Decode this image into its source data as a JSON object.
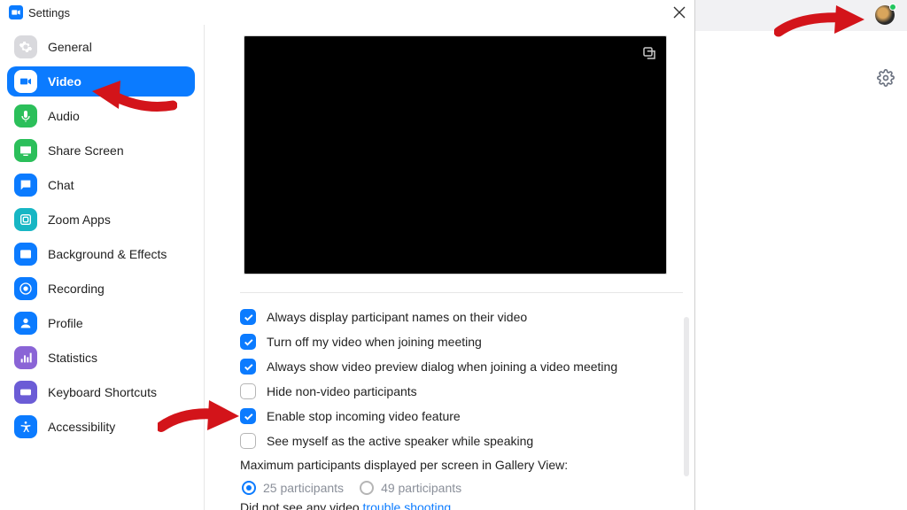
{
  "window": {
    "title": "Settings"
  },
  "sidebar": {
    "items": [
      {
        "label": "General",
        "color": "#d9d9dd",
        "icon": "gear"
      },
      {
        "label": "Video",
        "color": "#0b7bff",
        "icon": "video",
        "active": true
      },
      {
        "label": "Audio",
        "color": "#2bbf5a",
        "icon": "audio"
      },
      {
        "label": "Share Screen",
        "color": "#2bbf5a",
        "icon": "share"
      },
      {
        "label": "Chat",
        "color": "#0b7bff",
        "icon": "chat"
      },
      {
        "label": "Zoom Apps",
        "color": "#17b6c4",
        "icon": "apps"
      },
      {
        "label": "Background & Effects",
        "color": "#0b7bff",
        "icon": "bgfx"
      },
      {
        "label": "Recording",
        "color": "#0b7bff",
        "icon": "record"
      },
      {
        "label": "Profile",
        "color": "#0b7bff",
        "icon": "profile"
      },
      {
        "label": "Statistics",
        "color": "#8a64d6",
        "icon": "stats"
      },
      {
        "label": "Keyboard Shortcuts",
        "color": "#6b5cd6",
        "icon": "keys"
      },
      {
        "label": "Accessibility",
        "color": "#0b7bff",
        "icon": "a11y"
      }
    ]
  },
  "video": {
    "options": [
      {
        "label": "Always display participant names on their video",
        "checked": true
      },
      {
        "label": "Turn off my video when joining meeting",
        "checked": true
      },
      {
        "label": "Always show video preview dialog when joining a video meeting",
        "checked": true
      },
      {
        "label": "Hide non-video participants",
        "checked": false
      },
      {
        "label": "Enable stop incoming video feature",
        "checked": true
      },
      {
        "label": "See myself as the active speaker while speaking",
        "checked": false
      }
    ],
    "gallery_label": "Maximum participants displayed per screen in Gallery View:",
    "gallery_options": [
      {
        "label": "25 participants",
        "selected": true
      },
      {
        "label": "49 participants",
        "selected": false
      }
    ],
    "cutoff_text": "Did not see any video",
    "cutoff_link": "trouble shooting"
  }
}
